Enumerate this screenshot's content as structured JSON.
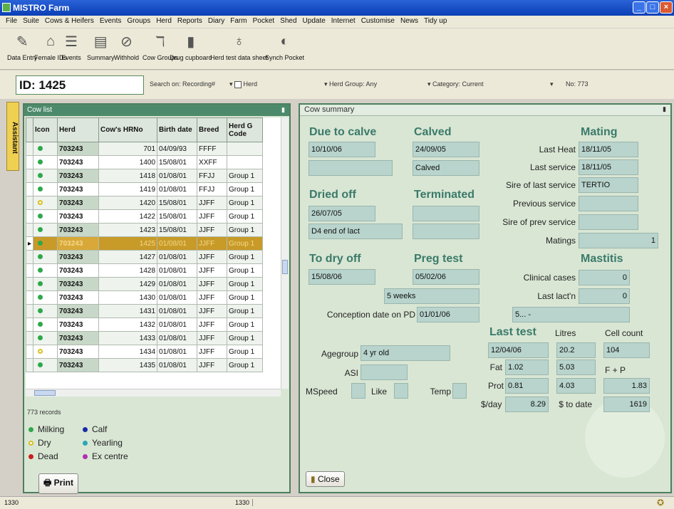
{
  "window": {
    "title": "MISTRO Farm"
  },
  "menu": [
    "File",
    "Suite",
    "Cows & Heifers",
    "Events",
    "Groups",
    "Herd",
    "Reports",
    "Diary",
    "Farm",
    "Pocket",
    "Shed",
    "Update",
    "Internet",
    "Customise",
    "News",
    "Tidy up"
  ],
  "toolbar": [
    {
      "label": "Data Entry",
      "icon": "pencil-icon",
      "glyph": "✎"
    },
    {
      "label": "Female IDs",
      "icon": "barn-icon",
      "glyph": "⌂"
    },
    {
      "label": "Events",
      "icon": "list-icon",
      "glyph": "☰"
    },
    {
      "label": "Summary",
      "icon": "summary-icon",
      "glyph": "▤"
    },
    {
      "label": "Withhold",
      "icon": "no-entry-icon",
      "glyph": "⊘"
    },
    {
      "label": "Cow Groups",
      "icon": "cow-groups-icon",
      "glyph": "ℸ"
    },
    {
      "label": "Drug cupboard",
      "icon": "bottle-icon",
      "glyph": "▮"
    },
    {
      "label": "Herd test data sheet",
      "icon": "herd-test-icon",
      "glyph": "♁"
    },
    {
      "label": "Synch Pocket",
      "icon": "sync-icon",
      "glyph": "◐"
    }
  ],
  "idbar": {
    "id_label": "ID:",
    "id_value": "1425",
    "search_on": "Search on: Recording#",
    "herd_label": "Herd",
    "herd_group": "Herd Group: Any",
    "category": "Category: Current",
    "no": "No: 773"
  },
  "assistant": "Assistant",
  "left": {
    "title": "Cow list",
    "columns": [
      "",
      "Icon",
      "Herd",
      "Cow's HRNo",
      "Birth date",
      "Breed",
      "Herd G Code"
    ],
    "rows": [
      {
        "icon": "green",
        "herd": "703243",
        "hrno": "701",
        "birth": "04/09/93",
        "breed": "FFFF",
        "group": ""
      },
      {
        "icon": "green",
        "herd": "703243",
        "hrno": "1400",
        "birth": "15/08/01",
        "breed": "XXFF",
        "group": ""
      },
      {
        "icon": "green",
        "herd": "703243",
        "hrno": "1418",
        "birth": "01/08/01",
        "breed": "FFJJ",
        "group": "Group 1"
      },
      {
        "icon": "green",
        "herd": "703243",
        "hrno": "1419",
        "birth": "01/08/01",
        "breed": "FFJJ",
        "group": "Group 1"
      },
      {
        "icon": "yellow",
        "herd": "703243",
        "hrno": "1420",
        "birth": "15/08/01",
        "breed": "JJFF",
        "group": "Group 1"
      },
      {
        "icon": "green",
        "herd": "703243",
        "hrno": "1422",
        "birth": "15/08/01",
        "breed": "JJFF",
        "group": "Group 1"
      },
      {
        "icon": "green",
        "herd": "703243",
        "hrno": "1423",
        "birth": "15/08/01",
        "breed": "JJFF",
        "group": "Group 1"
      },
      {
        "icon": "green",
        "herd": "703243",
        "hrno": "1425",
        "birth": "01/08/01",
        "breed": "JJFF",
        "group": "Group 1",
        "selected": true
      },
      {
        "icon": "green",
        "herd": "703243",
        "hrno": "1427",
        "birth": "01/08/01",
        "breed": "JJFF",
        "group": "Group 1"
      },
      {
        "icon": "green",
        "herd": "703243",
        "hrno": "1428",
        "birth": "01/08/01",
        "breed": "JJFF",
        "group": "Group 1"
      },
      {
        "icon": "green",
        "herd": "703243",
        "hrno": "1429",
        "birth": "01/08/01",
        "breed": "JJFF",
        "group": "Group 1"
      },
      {
        "icon": "green",
        "herd": "703243",
        "hrno": "1430",
        "birth": "01/08/01",
        "breed": "JJFF",
        "group": "Group 1"
      },
      {
        "icon": "green",
        "herd": "703243",
        "hrno": "1431",
        "birth": "01/08/01",
        "breed": "JJFF",
        "group": "Group 1"
      },
      {
        "icon": "green",
        "herd": "703243",
        "hrno": "1432",
        "birth": "01/08/01",
        "breed": "JJFF",
        "group": "Group 1"
      },
      {
        "icon": "green",
        "herd": "703243",
        "hrno": "1433",
        "birth": "01/08/01",
        "breed": "JJFF",
        "group": "Group 1"
      },
      {
        "icon": "yellow",
        "herd": "703243",
        "hrno": "1434",
        "birth": "01/08/01",
        "breed": "JJFF",
        "group": "Group 1"
      },
      {
        "icon": "green",
        "herd": "703243",
        "hrno": "1435",
        "birth": "01/08/01",
        "breed": "JJFF",
        "group": "Group 1"
      }
    ],
    "records": "773 records",
    "legend": [
      {
        "label": "Milking",
        "color": "#2ea84a"
      },
      {
        "label": "Calf",
        "color": "#1a2aa8"
      },
      {
        "label": "Dry",
        "color": "#d8c020"
      },
      {
        "label": "Yearling",
        "color": "#28a8b8"
      },
      {
        "label": "Dead",
        "color": "#c82020"
      },
      {
        "label": "Ex centre",
        "color": "#b030b0"
      }
    ],
    "print": "Print"
  },
  "summary": {
    "title": "Cow summary",
    "due_to_calve": "Due to calve",
    "due_date": "10/10/06",
    "due_2": "",
    "calved": "Calved",
    "calved_date": "24/09/05",
    "calved_status": "Calved",
    "mating": "Mating",
    "last_heat_lbl": "Last Heat",
    "last_heat": "18/11/05",
    "last_service_lbl": "Last service",
    "last_service": "18/11/05",
    "sire_last_lbl": "Sire of last service",
    "sire_last": "TERTIO",
    "prev_service_lbl": "Previous service",
    "prev_service": "",
    "sire_prev_lbl": "Sire of prev service",
    "sire_prev": "",
    "matings_lbl": "Matings",
    "matings": "1",
    "dried_off": "Dried off",
    "dried_date": "26/07/05",
    "dried_reason": "D4 end of lact",
    "terminated": "Terminated",
    "term_1": "",
    "term_2": "",
    "to_dry_off": "To dry off",
    "to_dry_date": "15/08/06",
    "preg_test": "Preg test",
    "preg_date": "05/02/06",
    "preg_weeks": "5 weeks",
    "conception_lbl": "Conception date on PD",
    "conception": "01/01/06",
    "mastitis": "Mastitis",
    "clinical_lbl": "Clinical cases",
    "clinical": "0",
    "last_lact_lbl": "Last lact'n",
    "last_lact": "0",
    "mastitis_note": "5... -",
    "last_test": "Last test",
    "litres_lbl": "Litres",
    "cellcount_lbl": "Cell count",
    "test_date": "12/04/06",
    "litres": "20.2",
    "cellcount": "104",
    "fat_lbl": "Fat",
    "fat": "1.02",
    "fat_pct": "5.03",
    "fp_lbl": "F + P",
    "prot_lbl": "Prot",
    "prot": "0.81",
    "prot_pct": "4.03",
    "fp": "1.83",
    "sday_lbl": "$/day",
    "sday": "8.29",
    "stodate_lbl": "$ to date",
    "stodate": "1619",
    "agegroup_lbl": "Agegroup",
    "agegroup": "4 yr old",
    "asi_lbl": "ASI",
    "asi": "",
    "mspeed_lbl": "MSpeed",
    "like_lbl": "Like",
    "temp_lbl": "Temp",
    "close": "Close"
  },
  "status": {
    "left": "1330",
    "mid": "1330"
  }
}
